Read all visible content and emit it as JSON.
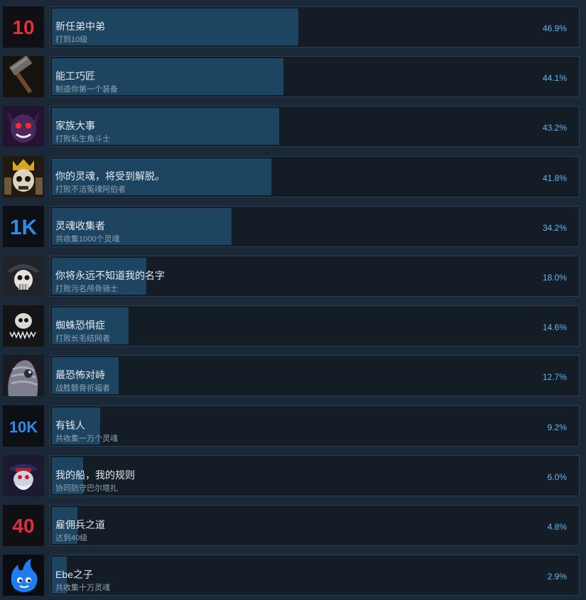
{
  "achievements": [
    {
      "title": "新任弟中弟",
      "desc": "打到10级",
      "percent": "46.9%",
      "fill": 0.469,
      "icon": "number-10-icon"
    },
    {
      "title": "能工巧匠",
      "desc": "制造你第一个装备",
      "percent": "44.1%",
      "fill": 0.441,
      "icon": "hammer-icon"
    },
    {
      "title": "家族大事",
      "desc": "打败私生角斗士",
      "percent": "43.2%",
      "fill": 0.432,
      "icon": "horned-demon-icon"
    },
    {
      "title": "你的灵魂，将受到解脱。",
      "desc": "打败不洁冤魂阿伯者",
      "percent": "41.8%",
      "fill": 0.418,
      "icon": "armored-skull-king-icon"
    },
    {
      "title": "灵魂收集者",
      "desc": "共收集1000个灵魂",
      "percent": "34.2%",
      "fill": 0.342,
      "icon": "text-1k-icon"
    },
    {
      "title": "你将永远不知道我的名字",
      "desc": "打败污名颅骨骑士",
      "percent": "18.0%",
      "fill": 0.18,
      "icon": "skull-knight-icon"
    },
    {
      "title": "蜘蛛恐惧症",
      "desc": "打败长毛结网者",
      "percent": "14.6%",
      "fill": 0.146,
      "icon": "fanged-skull-icon"
    },
    {
      "title": "最恐怖对峙",
      "desc": "战胜骸骨祈福者",
      "percent": "12.7%",
      "fill": 0.127,
      "icon": "bone-priest-icon"
    },
    {
      "title": "有钱人",
      "desc": "共收集一万个灵魂",
      "percent": "9.2%",
      "fill": 0.092,
      "icon": "text-10k-icon"
    },
    {
      "title": "我的船，我的规则",
      "desc": "协同防守巴尔塔扎",
      "percent": "6.0%",
      "fill": 0.06,
      "icon": "pirate-captain-icon"
    },
    {
      "title": "雇佣兵之道",
      "desc": "达到40级",
      "percent": "4.8%",
      "fill": 0.048,
      "icon": "number-40-icon"
    },
    {
      "title": "Ebe之子",
      "desc": "共收集十万灵魂",
      "percent": "2.9%",
      "fill": 0.029,
      "icon": "blue-flame-spirit-icon"
    }
  ],
  "colors": {
    "background": "#1b2838",
    "card": "#141c25",
    "fill": "#1d4460",
    "percent": "#61b8f0",
    "red_icon_text": "#e0303a",
    "blue_icon_text": "#2f8ae8"
  }
}
